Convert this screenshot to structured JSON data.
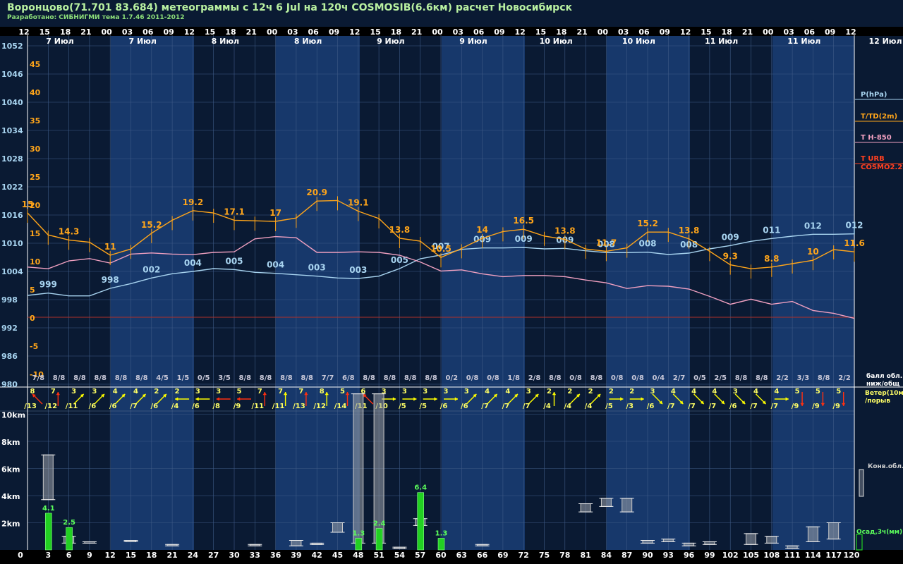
{
  "header": {
    "title": "Воронцово(71.701 83.684) метеограммы с  12ч 6 Jul на 120ч COSMOSIB(6.6км) расчет Новосибирск",
    "subtitle": "Разработано: СИБНИГМИ тема 1.7.46 2011-2012"
  },
  "colors": {
    "background": "#0a1a33",
    "band": "#17386b",
    "pressure": "#a8d4f0",
    "temperature": "#ffa51a",
    "t850": "#f0a0c0",
    "urb": "#ff4020",
    "precip": "#22d022",
    "wind_arrow": "#ffff00",
    "wind_arrow_strong": "#ff3010",
    "cloud": "#c8c8c8",
    "zero_line": "#b03028"
  },
  "chart_data": {
    "type": "line",
    "hours_top": [
      "12",
      "15",
      "18",
      "21",
      "00",
      "03",
      "06",
      "09",
      "12",
      "15",
      "18",
      "21",
      "00",
      "03",
      "06",
      "09",
      "12",
      "15",
      "18",
      "21",
      "00",
      "03",
      "06",
      "09",
      "12",
      "15",
      "18",
      "21",
      "00",
      "03",
      "06",
      "09",
      "12",
      "15",
      "18",
      "21",
      "00",
      "03",
      "06",
      "09",
      "12"
    ],
    "day_labels": [
      "7 Июл",
      "7 Июл",
      "8 Июл",
      "8 Июл",
      "9 Июл",
      "9 Июл",
      "10 Июл",
      "10 Июл",
      "11 Июл",
      "11 Июл",
      "12 Июл"
    ],
    "forecast_hours": [
      0,
      3,
      6,
      9,
      12,
      15,
      18,
      21,
      24,
      27,
      30,
      33,
      36,
      39,
      42,
      45,
      48,
      51,
      54,
      57,
      60,
      63,
      66,
      69,
      72,
      75,
      78,
      81,
      84,
      87,
      90,
      93,
      96,
      99,
      102,
      105,
      108,
      111,
      114,
      117,
      120
    ],
    "pressure_axis": {
      "ticks": [
        1052,
        1046,
        1040,
        1034,
        1028,
        1022,
        1016,
        1010,
        1004,
        998,
        992,
        986,
        980
      ],
      "range": [
        980,
        1054
      ]
    },
    "temperature_axis": {
      "ticks": [
        45,
        40,
        35,
        30,
        25,
        20,
        15,
        10,
        5,
        0,
        -5,
        -10
      ]
    },
    "legend": [
      "P(hPa)",
      "T/TD(2m)",
      "T H-850",
      "T URB",
      "COSMO2.2"
    ],
    "series": [
      {
        "name": "P(hPa)",
        "values": [
          998.9,
          999.4,
          998.8,
          998.8,
          1000.4,
          1001.4,
          1002.6,
          1003.5,
          1004.0,
          1004.6,
          1004.4,
          1003.8,
          1003.6,
          1003.3,
          1003.0,
          1002.6,
          1002.5,
          1003.0,
          1004.6,
          1006.7,
          1007.5,
          1008.7,
          1009.0,
          1009.0,
          1009.1,
          1008.8,
          1008.9,
          1008.4,
          1008.0,
          1008.0,
          1008.1,
          1007.6,
          1007.9,
          1008.8,
          1009.5,
          1010.4,
          1011.0,
          1011.5,
          1011.9,
          1011.9,
          1012.0,
          1013.8
        ],
        "labels": [
          {
            "i": 1,
            "text": "999"
          },
          {
            "i": 4,
            "text": "998"
          },
          {
            "i": 6,
            "text": "002"
          },
          {
            "i": 8,
            "text": "004"
          },
          {
            "i": 10,
            "text": "005"
          },
          {
            "i": 12,
            "text": "004"
          },
          {
            "i": 14,
            "text": "003"
          },
          {
            "i": 16,
            "text": "003"
          },
          {
            "i": 18,
            "text": "005"
          },
          {
            "i": 20,
            "text": "007"
          },
          {
            "i": 22,
            "text": "009"
          },
          {
            "i": 24,
            "text": "009"
          },
          {
            "i": 26,
            "text": "009"
          },
          {
            "i": 28,
            "text": "008"
          },
          {
            "i": 30,
            "text": "008"
          },
          {
            "i": 32,
            "text": "008"
          },
          {
            "i": 34,
            "text": "009"
          },
          {
            "i": 36,
            "text": "011"
          },
          {
            "i": 38,
            "text": "012"
          },
          {
            "i": 40,
            "text": "012"
          }
        ]
      },
      {
        "name": "T/TD(2m)",
        "values": [
          18.5,
          14.6,
          13.7,
          13.3,
          11.0,
          12.1,
          14.9,
          17.2,
          18.9,
          18.5,
          17.2,
          17.1,
          17.0,
          17.6,
          20.6,
          20.7,
          18.8,
          17.5,
          14.0,
          13.5,
          10.6,
          12.2,
          14.0,
          15.2,
          15.6,
          14.4,
          13.8,
          12.1,
          11.7,
          12.3,
          15.1,
          15.1,
          13.9,
          11.7,
          9.3,
          8.6,
          8.9,
          9.5,
          10.1,
          12.0,
          11.6
        ],
        "labels": [
          {
            "i": 0,
            "text": "15"
          },
          {
            "i": 2,
            "text": "14.3"
          },
          {
            "i": 4,
            "text": "11"
          },
          {
            "i": 6,
            "text": "15.2"
          },
          {
            "i": 8,
            "text": "19.2"
          },
          {
            "i": 10,
            "text": "17.1"
          },
          {
            "i": 12,
            "text": "17"
          },
          {
            "i": 14,
            "text": "20.9"
          },
          {
            "i": 16,
            "text": "19.1"
          },
          {
            "i": 18,
            "text": "13.8"
          },
          {
            "i": 20,
            "text": "10.5"
          },
          {
            "i": 22,
            "text": "14"
          },
          {
            "i": 24,
            "text": "16.5"
          },
          {
            "i": 26,
            "text": "13.8"
          },
          {
            "i": 28,
            "text": "11.7"
          },
          {
            "i": 30,
            "text": "15.2"
          },
          {
            "i": 32,
            "text": "13.8"
          },
          {
            "i": 34,
            "text": "9.3"
          },
          {
            "i": 36,
            "text": "8.8"
          },
          {
            "i": 38,
            "text": "10"
          },
          {
            "i": 40,
            "text": "11.6"
          }
        ]
      },
      {
        "name": "T H-850",
        "values": [
          8.9,
          8.6,
          10.0,
          10.4,
          9.6,
          11.2,
          11.4,
          11.2,
          11.1,
          11.5,
          11.6,
          13.9,
          14.3,
          14.1,
          11.5,
          11.5,
          11.6,
          11.5,
          11.0,
          9.8,
          8.2,
          8.4,
          7.7,
          7.2,
          7.4,
          7.4,
          7.2,
          6.6,
          6.1,
          5.1,
          5.6,
          5.5,
          5.0,
          3.7,
          2.3,
          3.2,
          2.3,
          2.8,
          1.2,
          0.7,
          -0.2
        ]
      }
    ],
    "wind": [
      {
        "dir": "NW",
        "s": 8,
        "g": 13
      },
      {
        "dir": "N",
        "s": 7,
        "g": 12
      },
      {
        "dir": "NE",
        "s": 3,
        "g": 11
      },
      {
        "dir": "NE",
        "s": 3,
        "g": 6
      },
      {
        "dir": "NE",
        "s": 4,
        "g": 6
      },
      {
        "dir": "NE",
        "s": 4,
        "g": 7
      },
      {
        "dir": "NE",
        "s": 2,
        "g": 6
      },
      {
        "dir": "W",
        "s": 2,
        "g": 4
      },
      {
        "dir": "W",
        "s": 3,
        "g": 6
      },
      {
        "dir": "W",
        "s": 3,
        "g": 8
      },
      {
        "dir": "W",
        "s": 5,
        "g": 9
      },
      {
        "dir": "N",
        "s": 7,
        "g": 11
      },
      {
        "dir": "N",
        "s": 7,
        "g": 11
      },
      {
        "dir": "N",
        "s": 7,
        "g": 13
      },
      {
        "dir": "N",
        "s": 8,
        "g": 12
      },
      {
        "dir": "N",
        "s": 5,
        "g": 14
      },
      {
        "dir": "NW",
        "s": 6,
        "g": 11
      },
      {
        "dir": "E",
        "s": 3,
        "g": 10
      },
      {
        "dir": "E",
        "s": 3,
        "g": 5
      },
      {
        "dir": "E",
        "s": 3,
        "g": 5
      },
      {
        "dir": "E",
        "s": 3,
        "g": 6
      },
      {
        "dir": "NE",
        "s": 3,
        "g": 6
      },
      {
        "dir": "NE",
        "s": 4,
        "g": 7
      },
      {
        "dir": "NE",
        "s": 4,
        "g": 7
      },
      {
        "dir": "NE",
        "s": 3,
        "g": 7
      },
      {
        "dir": "N",
        "s": 2,
        "g": 4
      },
      {
        "dir": "NE",
        "s": 2,
        "g": 4
      },
      {
        "dir": "NE",
        "s": 2,
        "g": 4
      },
      {
        "dir": "E",
        "s": 2,
        "g": 5
      },
      {
        "dir": "E",
        "s": 2,
        "g": 3
      },
      {
        "dir": "SE",
        "s": 3,
        "g": 6
      },
      {
        "dir": "SE",
        "s": 4,
        "g": 7
      },
      {
        "dir": "SE",
        "s": 4,
        "g": 7
      },
      {
        "dir": "SE",
        "s": 4,
        "g": 7
      },
      {
        "dir": "SE",
        "s": 3,
        "g": 6
      },
      {
        "dir": "SE",
        "s": 4,
        "g": 7
      },
      {
        "dir": "E",
        "s": 4,
        "g": 7
      },
      {
        "dir": "S",
        "s": 5,
        "g": 9
      },
      {
        "dir": "S",
        "s": 5,
        "g": 9
      },
      {
        "dir": "S",
        "s": 5,
        "g": 9
      }
    ],
    "wind_strong": [
      0,
      1,
      9,
      10,
      11,
      13,
      15,
      16,
      37,
      38,
      39
    ],
    "cloud_fraction": [
      "7/8",
      "8/8",
      "8/8",
      "8/8",
      "8/8",
      "8/8",
      "4/5",
      "1/5",
      "0/5",
      "3/5",
      "8/8",
      "8/8",
      "8/8",
      "8/8",
      "7/7",
      "6/8",
      "8/8",
      "8/8",
      "8/8",
      "8/8",
      "0/2",
      "0/8",
      "0/8",
      "1/8",
      "2/8",
      "8/8",
      "0/8",
      "8/8",
      "0/8",
      "0/8",
      "0/4",
      "2/7",
      "0/5",
      "2/5",
      "8/8",
      "8/8",
      "2/2",
      "3/3",
      "8/8",
      "2/2"
    ],
    "cloud_fraction_label": "балл обл. ниж/общ",
    "wind_label": "Ветер(10м) /порыв",
    "height_axis": {
      "ticks": [
        "10km",
        "8km",
        "6km",
        "4km",
        "2km"
      ],
      "range_km": [
        0,
        11.5
      ]
    },
    "precip": [
      {
        "h": 3,
        "mm": 4.1
      },
      {
        "h": 6,
        "mm": 2.5
      },
      {
        "h": 48,
        "mm": 1.3
      },
      {
        "h": 51,
        "mm": 2.4
      },
      {
        "h": 57,
        "mm": 6.4
      },
      {
        "h": 60,
        "mm": 1.3
      }
    ],
    "clouds_conv": [
      {
        "h": 3,
        "bottom": 3.7,
        "top": 7.0
      },
      {
        "h": 6,
        "bottom": 0.5,
        "top": 1.0
      },
      {
        "h": 9,
        "bottom": 0.5,
        "top": 0.6
      },
      {
        "h": 15,
        "bottom": 0.6,
        "top": 0.7
      },
      {
        "h": 21,
        "bottom": 0.3,
        "top": 0.4
      },
      {
        "h": 33,
        "bottom": 0.3,
        "top": 0.4
      },
      {
        "h": 39,
        "bottom": 0.3,
        "top": 0.7
      },
      {
        "h": 42,
        "bottom": 0.4,
        "top": 0.5
      },
      {
        "h": 45,
        "bottom": 1.3,
        "top": 2.0
      },
      {
        "h": 48,
        "bottom": 0.5,
        "top": 11.5
      },
      {
        "h": 51,
        "bottom": 0.5,
        "top": 11.5
      },
      {
        "h": 54,
        "bottom": 0.1,
        "top": 0.2
      },
      {
        "h": 57,
        "bottom": 1.8,
        "top": 2.3
      },
      {
        "h": 66,
        "bottom": 0.3,
        "top": 0.4
      },
      {
        "h": 81,
        "bottom": 2.8,
        "top": 3.4
      },
      {
        "h": 84,
        "bottom": 3.2,
        "top": 3.8
      },
      {
        "h": 87,
        "bottom": 2.8,
        "top": 3.8
      },
      {
        "h": 90,
        "bottom": 0.5,
        "top": 0.7
      },
      {
        "h": 93,
        "bottom": 0.6,
        "top": 0.8
      },
      {
        "h": 96,
        "bottom": 0.3,
        "top": 0.5
      },
      {
        "h": 99,
        "bottom": 0.4,
        "top": 0.6
      },
      {
        "h": 105,
        "bottom": 0.4,
        "top": 1.2
      },
      {
        "h": 108,
        "bottom": 0.5,
        "top": 1.0
      },
      {
        "h": 111,
        "bottom": 0.1,
        "top": 0.3
      },
      {
        "h": 114,
        "bottom": 0.6,
        "top": 1.7
      },
      {
        "h": 117,
        "bottom": 0.8,
        "top": 2.0
      }
    ],
    "conv_label": "Конв.обл.",
    "precip_label": "Осад,3ч(мм)"
  }
}
